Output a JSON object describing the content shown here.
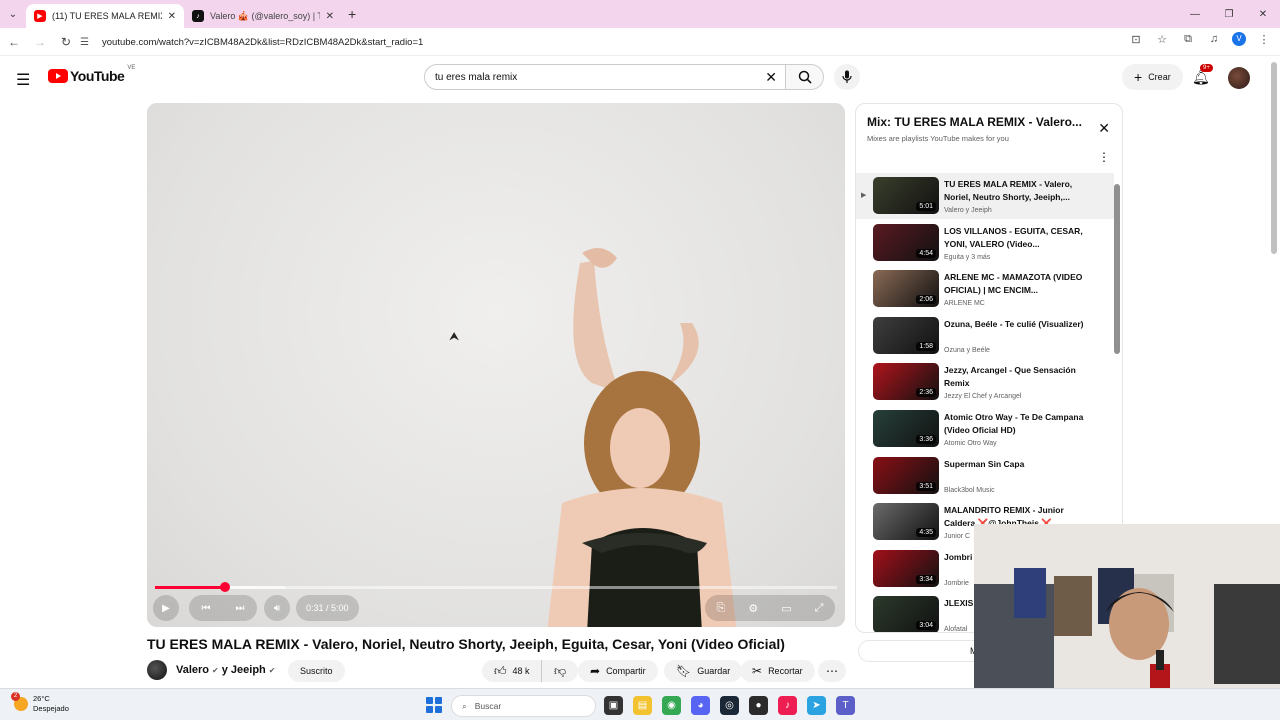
{
  "browser": {
    "tabs": [
      {
        "title": "(11) TU ERES MALA REMIX - Va",
        "active": true
      },
      {
        "title": "Valero 🎪 (@valero_soy) | TikTo",
        "active": false
      }
    ],
    "url": "youtube.com/watch?v=zICBM48A2Dk&list=RDzICBM48A2Dk&start_radio=1",
    "profile_initial": "V"
  },
  "header": {
    "logo_text": "YouTube",
    "country_code": "VE",
    "search_value": "tu eres mala remix",
    "create_label": "Crear",
    "notifications_badge": "9+"
  },
  "player": {
    "time": "0:31 / 5:00",
    "progress_fraction": 0.103,
    "loaded_fraction": 0.19
  },
  "video": {
    "title": "TU ERES MALA REMIX - Valero, Noriel, Neutro Shorty, Jeeiph, Eguita, Cesar, Yoni (Video Oficial)",
    "channel_a": "Valero",
    "joiner": "y",
    "channel_b": "Jeeiph",
    "subscribe_label": "Suscrito",
    "likes": "48 k",
    "share_label": "Compartir",
    "save_label": "Guardar",
    "clip_label": "Recortar"
  },
  "playlist": {
    "title": "Mix: TU ERES MALA REMIX - Valero...",
    "subtitle": "Mixes are playlists YouTube makes for you",
    "show_more_label": "Mostrar la",
    "items": [
      {
        "title": "TU ERES MALA REMIX - Valero, Noriel, Neutro Shorty, Jeeiph,...",
        "meta": "Valero y Jeeiph",
        "duration": "5:01",
        "active": true,
        "color": "#3a3f2c"
      },
      {
        "title": "LOS VILLANOS - EGUITA, CESAR, YONI, VALERO (Video...",
        "meta": "Eguita y 3 más",
        "duration": "4:54",
        "color": "#5a1a22"
      },
      {
        "title": "ARLENE MC - MAMAZOTA (VIDEO OFICIAL) | MC ENCIM...",
        "meta": "ARLENE MC",
        "duration": "2:06",
        "color": "#8a6a55"
      },
      {
        "title": "Ozuna, Beéle - Te culié (Visualizer)",
        "meta": "Ozuna y Beéle",
        "duration": "1:58",
        "color": "#3e3e3e"
      },
      {
        "title": "Jezzy, Arcangel - Que Sensación Remix",
        "meta": "Jezzy El Chef y Arcangel",
        "duration": "2:36",
        "color": "#b0141c"
      },
      {
        "title": "Atomic Otro Way - Te De Campana (Video Oficial HD)",
        "meta": "Atomic Otro Way",
        "duration": "3:36",
        "color": "#27403a"
      },
      {
        "title": "Superman Sin Capa",
        "meta": "Black3bol Music",
        "duration": "3:51",
        "color": "#8a0f15"
      },
      {
        "title": "MALANDRITO REMIX - Junior Caldera ❌@JohnTheis ❌...",
        "meta": "Junior C",
        "duration": "4:35",
        "color": "#6b6b6b"
      },
      {
        "title": "Jombri (Video",
        "meta": "Jombrie",
        "duration": "3:34",
        "color": "#a3101a"
      },
      {
        "title": "JLEXIS SHADO",
        "meta": "Alofatal",
        "duration": "3:04",
        "color": "#2c3a2c"
      }
    ]
  },
  "taskbar": {
    "temperature": "26°C",
    "weather": "Despejado",
    "weather_badge": "2",
    "search_placeholder": "Buscar"
  }
}
